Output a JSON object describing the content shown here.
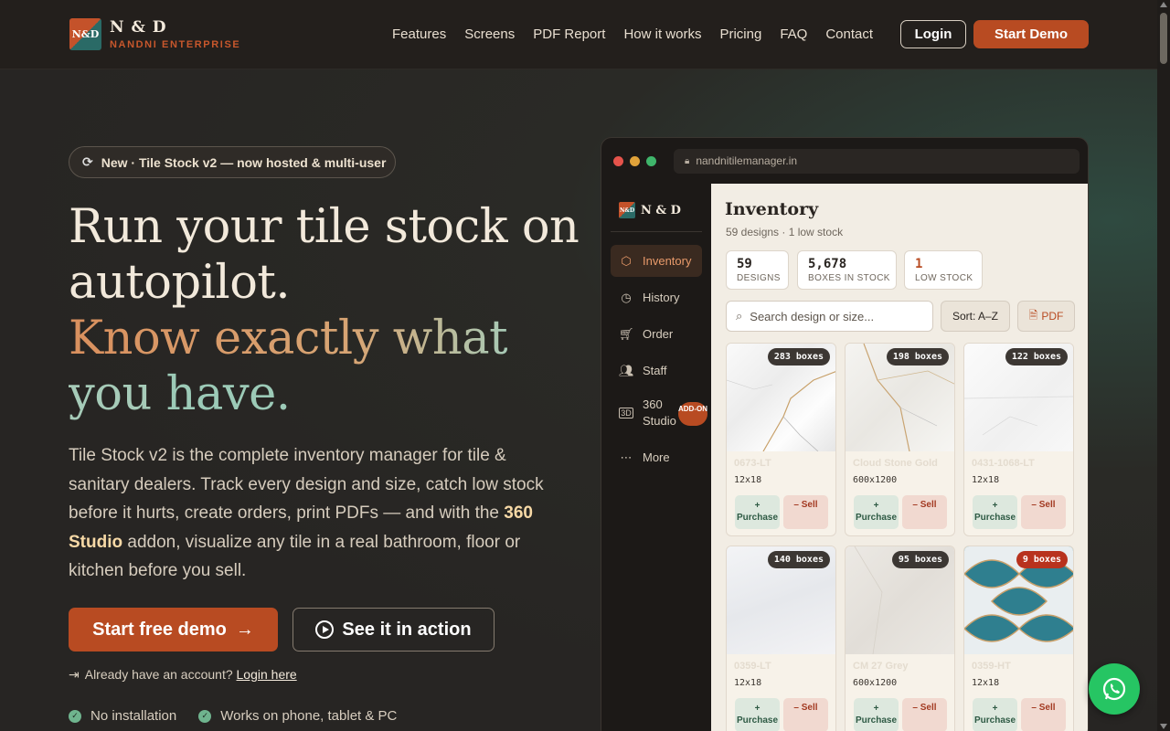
{
  "brand": {
    "logo_text": "N&D",
    "title": "N & D",
    "subtitle": "NANDNI ENTERPRISE"
  },
  "nav": {
    "links": [
      "Features",
      "Screens",
      "PDF Report",
      "How it works",
      "Pricing",
      "FAQ",
      "Contact"
    ],
    "login": "Login",
    "start_demo": "Start Demo"
  },
  "hero": {
    "pill": "New · Tile Stock v2 — now hosted & multi-user",
    "headline_line1": "Run your tile stock on autopilot.",
    "headline_line2a": "Know exactly what you",
    "headline_line2b": "have.",
    "desc_before": "Tile Stock v2 is the complete inventory manager for tile & sanitary dealers. Track every design and size, catch low stock before it hurts, create orders, print PDFs — and with the ",
    "desc_bold": "360 Studio",
    "desc_after": " addon, visualize any tile in a real bathroom, floor or kitchen before you sell.",
    "cta_primary": "Start free demo",
    "cta_secondary": "See it in action",
    "account_text": "Already have an account?",
    "account_link": "Login here",
    "checks": [
      "No installation",
      "Works on phone, tablet & PC"
    ]
  },
  "mock": {
    "url": "nandnitilemanager.in",
    "side_brand": "N & D",
    "side_items": [
      {
        "label": "Inventory",
        "icon": "box-icon"
      },
      {
        "label": "History",
        "icon": "clock-icon"
      },
      {
        "label": "Order",
        "icon": "cart-icon"
      },
      {
        "label": "Staff",
        "icon": "users-icon"
      },
      {
        "label": "360 Studio",
        "icon": "3d-icon",
        "badge": "ADD-ON"
      },
      {
        "label": "More",
        "icon": "dots-icon"
      }
    ],
    "title": "Inventory",
    "subtitle": "59 designs · 1 low stock",
    "stats": [
      {
        "value": "59",
        "label": "DESIGNS"
      },
      {
        "value": "5,678",
        "label": "BOXES IN STOCK"
      },
      {
        "value": "1",
        "label": "LOW STOCK"
      }
    ],
    "search_placeholder": "Search design or size...",
    "sort": "Sort: A–Z",
    "pdf": "PDF",
    "buy_label": "+ Purchase",
    "sell_label": "– Sell",
    "cards": [
      {
        "badge": "283 boxes",
        "name": "0673-LT",
        "size": "12x18"
      },
      {
        "badge": "198 boxes",
        "name": "Cloud Stone Gold",
        "size": "600x1200"
      },
      {
        "badge": "122 boxes",
        "name": "0431-1068-LT",
        "size": "12x18"
      },
      {
        "badge": "140 boxes",
        "name": "0359-LT",
        "size": "12x18"
      },
      {
        "badge": "95 boxes",
        "name": "CM 27 Grey",
        "size": "600x1200"
      },
      {
        "badge": "9 boxes",
        "name": "0359-HT",
        "size": "12x18",
        "low": true
      }
    ]
  }
}
